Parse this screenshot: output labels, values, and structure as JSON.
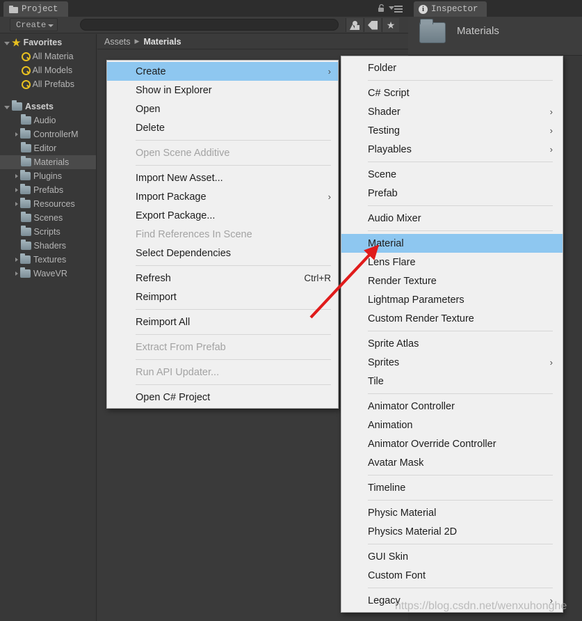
{
  "project_panel": {
    "tab_label": "Project",
    "tab_icon": "folder-icon",
    "lock_icon": "lock-icon",
    "menu_icon": "panel-menu-icon",
    "create_button": "Create",
    "search_placeholder": "",
    "search_value": "",
    "filters": [
      {
        "name": "filter-by-type",
        "icon": "shapes-icon"
      },
      {
        "name": "filter-by-label",
        "icon": "tag-icon"
      },
      {
        "name": "filter-by-favorite",
        "icon": "star-icon"
      }
    ],
    "breadcrumb": [
      {
        "label": "Assets",
        "active": false
      },
      {
        "label": "Materials",
        "active": true
      }
    ],
    "tree": [
      {
        "label": "Favorites",
        "indent": 0,
        "arrow": "down",
        "icon": "star-icon",
        "bold": true,
        "selected": false
      },
      {
        "label": "All Materia",
        "indent": 1,
        "arrow": "none",
        "icon": "search-icon",
        "bold": false,
        "selected": false
      },
      {
        "label": "All Models",
        "indent": 1,
        "arrow": "none",
        "icon": "search-icon",
        "bold": false,
        "selected": false
      },
      {
        "label": "All Prefabs",
        "indent": 1,
        "arrow": "none",
        "icon": "search-icon",
        "bold": false,
        "selected": false
      },
      {
        "label": "",
        "indent": 0,
        "arrow": "none",
        "icon": "none",
        "bold": false,
        "selected": false
      },
      {
        "label": "Assets",
        "indent": 0,
        "arrow": "down",
        "icon": "folder-icon",
        "bold": true,
        "selected": false
      },
      {
        "label": "Audio",
        "indent": 1,
        "arrow": "none",
        "icon": "folder-icon",
        "bold": false,
        "selected": false
      },
      {
        "label": "ControllerM",
        "indent": 1,
        "arrow": "right",
        "icon": "folder-icon",
        "bold": false,
        "selected": false
      },
      {
        "label": "Editor",
        "indent": 1,
        "arrow": "none",
        "icon": "folder-icon",
        "bold": false,
        "selected": false
      },
      {
        "label": "Materials",
        "indent": 1,
        "arrow": "none",
        "icon": "folder-icon",
        "bold": false,
        "selected": true
      },
      {
        "label": "Plugins",
        "indent": 1,
        "arrow": "right",
        "icon": "folder-icon",
        "bold": false,
        "selected": false
      },
      {
        "label": "Prefabs",
        "indent": 1,
        "arrow": "right",
        "icon": "folder-icon",
        "bold": false,
        "selected": false
      },
      {
        "label": "Resources",
        "indent": 1,
        "arrow": "right",
        "icon": "folder-icon",
        "bold": false,
        "selected": false
      },
      {
        "label": "Scenes",
        "indent": 1,
        "arrow": "none",
        "icon": "folder-icon",
        "bold": false,
        "selected": false
      },
      {
        "label": "Scripts",
        "indent": 1,
        "arrow": "none",
        "icon": "folder-icon",
        "bold": false,
        "selected": false
      },
      {
        "label": "Shaders",
        "indent": 1,
        "arrow": "none",
        "icon": "folder-icon",
        "bold": false,
        "selected": false
      },
      {
        "label": "Textures",
        "indent": 1,
        "arrow": "right",
        "icon": "folder-icon",
        "bold": false,
        "selected": false
      },
      {
        "label": "WaveVR",
        "indent": 1,
        "arrow": "right",
        "icon": "folder-icon",
        "bold": false,
        "selected": false
      }
    ]
  },
  "inspector": {
    "tab_label": "Inspector",
    "tab_icon": "info-icon",
    "asset_name": "Materials",
    "asset_icon": "folder-icon"
  },
  "context_menu": {
    "items": [
      {
        "label": "Create",
        "selected": true,
        "disabled": false,
        "submenu": true,
        "shortcut": ""
      },
      {
        "label": "Show in Explorer",
        "selected": false,
        "disabled": false,
        "submenu": false,
        "shortcut": ""
      },
      {
        "label": "Open",
        "selected": false,
        "disabled": false,
        "submenu": false,
        "shortcut": ""
      },
      {
        "label": "Delete",
        "selected": false,
        "disabled": false,
        "submenu": false,
        "shortcut": ""
      },
      {
        "separator": true
      },
      {
        "label": "Open Scene Additive",
        "selected": false,
        "disabled": true,
        "submenu": false,
        "shortcut": ""
      },
      {
        "separator": true
      },
      {
        "label": "Import New Asset...",
        "selected": false,
        "disabled": false,
        "submenu": false,
        "shortcut": ""
      },
      {
        "label": "Import Package",
        "selected": false,
        "disabled": false,
        "submenu": true,
        "shortcut": ""
      },
      {
        "label": "Export Package...",
        "selected": false,
        "disabled": false,
        "submenu": false,
        "shortcut": ""
      },
      {
        "label": "Find References In Scene",
        "selected": false,
        "disabled": true,
        "submenu": false,
        "shortcut": ""
      },
      {
        "label": "Select Dependencies",
        "selected": false,
        "disabled": false,
        "submenu": false,
        "shortcut": ""
      },
      {
        "separator": true
      },
      {
        "label": "Refresh",
        "selected": false,
        "disabled": false,
        "submenu": false,
        "shortcut": "Ctrl+R"
      },
      {
        "label": "Reimport",
        "selected": false,
        "disabled": false,
        "submenu": false,
        "shortcut": ""
      },
      {
        "separator": true
      },
      {
        "label": "Reimport All",
        "selected": false,
        "disabled": false,
        "submenu": false,
        "shortcut": ""
      },
      {
        "separator": true
      },
      {
        "label": "Extract From Prefab",
        "selected": false,
        "disabled": true,
        "submenu": false,
        "shortcut": ""
      },
      {
        "separator": true
      },
      {
        "label": "Run API Updater...",
        "selected": false,
        "disabled": true,
        "submenu": false,
        "shortcut": ""
      },
      {
        "separator": true
      },
      {
        "label": "Open C# Project",
        "selected": false,
        "disabled": false,
        "submenu": false,
        "shortcut": ""
      }
    ]
  },
  "create_submenu": {
    "items": [
      {
        "label": "Folder",
        "selected": false,
        "submenu": false
      },
      {
        "separator": true
      },
      {
        "label": "C# Script",
        "selected": false,
        "submenu": false
      },
      {
        "label": "Shader",
        "selected": false,
        "submenu": true
      },
      {
        "label": "Testing",
        "selected": false,
        "submenu": true
      },
      {
        "label": "Playables",
        "selected": false,
        "submenu": true
      },
      {
        "separator": true
      },
      {
        "label": "Scene",
        "selected": false,
        "submenu": false
      },
      {
        "label": "Prefab",
        "selected": false,
        "submenu": false
      },
      {
        "separator": true
      },
      {
        "label": "Audio Mixer",
        "selected": false,
        "submenu": false
      },
      {
        "separator": true
      },
      {
        "label": "Material",
        "selected": true,
        "submenu": false
      },
      {
        "label": "Lens Flare",
        "selected": false,
        "submenu": false
      },
      {
        "label": "Render Texture",
        "selected": false,
        "submenu": false
      },
      {
        "label": "Lightmap Parameters",
        "selected": false,
        "submenu": false
      },
      {
        "label": "Custom Render Texture",
        "selected": false,
        "submenu": false
      },
      {
        "separator": true
      },
      {
        "label": "Sprite Atlas",
        "selected": false,
        "submenu": false
      },
      {
        "label": "Sprites",
        "selected": false,
        "submenu": true
      },
      {
        "label": "Tile",
        "selected": false,
        "submenu": false
      },
      {
        "separator": true
      },
      {
        "label": "Animator Controller",
        "selected": false,
        "submenu": false
      },
      {
        "label": "Animation",
        "selected": false,
        "submenu": false
      },
      {
        "label": "Animator Override Controller",
        "selected": false,
        "submenu": false
      },
      {
        "label": "Avatar Mask",
        "selected": false,
        "submenu": false
      },
      {
        "separator": true
      },
      {
        "label": "Timeline",
        "selected": false,
        "submenu": false
      },
      {
        "separator": true
      },
      {
        "label": "Physic Material",
        "selected": false,
        "submenu": false
      },
      {
        "label": "Physics Material 2D",
        "selected": false,
        "submenu": false
      },
      {
        "separator": true
      },
      {
        "label": "GUI Skin",
        "selected": false,
        "submenu": false
      },
      {
        "label": "Custom Font",
        "selected": false,
        "submenu": false
      },
      {
        "separator": true
      },
      {
        "label": "Legacy",
        "selected": false,
        "submenu": true
      }
    ]
  },
  "annotation": {
    "arrow_color": "#e01b1b",
    "points_to": "Material"
  },
  "watermark": {
    "text": "https://blog.csdn.net/wenxuhonghe"
  },
  "colors": {
    "panel_bg": "#383838",
    "menu_bg": "#f0f0f0",
    "highlight": "#8ec7f0",
    "folder": "#8d9ba3",
    "star": "#e8c020"
  }
}
